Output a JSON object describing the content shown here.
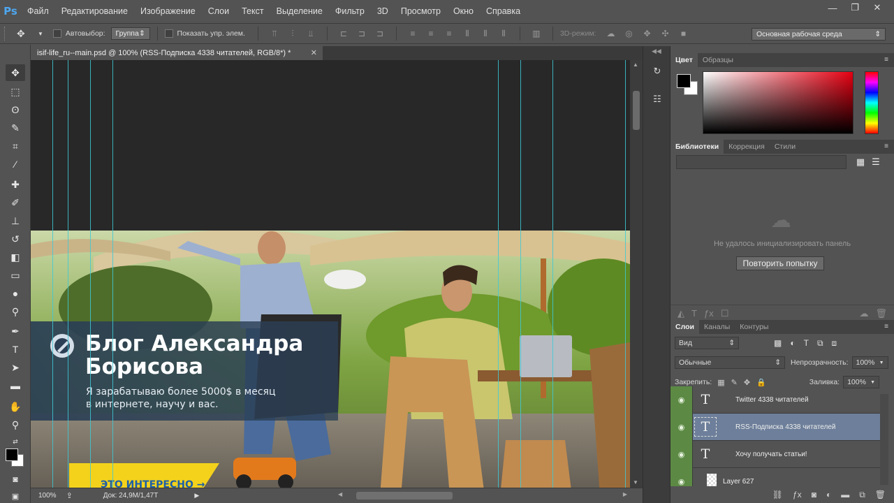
{
  "app": {
    "logo": "Ps"
  },
  "menu": [
    "Файл",
    "Редактирование",
    "Изображение",
    "Слои",
    "Текст",
    "Выделение",
    "Фильтр",
    "3D",
    "Просмотр",
    "Окно",
    "Справка"
  ],
  "window_controls": [
    "—",
    "❐",
    "✕"
  ],
  "options": {
    "autoselect_label": "Автовыбор:",
    "autoselect_value": "Группа",
    "show_transform_label": "Показать упр. элем.",
    "mode3d_label": "3D-режим:",
    "workspace": "Основная рабочая среда"
  },
  "document": {
    "tab_title": "isif-life_ru--main.psd @ 100% (RSS-Подписка 4338 читателей, RGB/8*) *",
    "zoom": "100%",
    "doc_size": "Док: 24,9М/1,47Т"
  },
  "banner": {
    "title_line1": "Блог Александра",
    "title_line2": "Борисова",
    "subtitle_line1": "Я зарабатываю более 5000$ в месяц",
    "subtitle_line2": "в интернете, научу и вас.",
    "cta": "ЭТО ИНТЕРЕСНО →"
  },
  "color_panel": {
    "tabs": [
      "Цвет",
      "Образцы"
    ]
  },
  "libraries_panel": {
    "tabs": [
      "Библиотеки",
      "Коррекция",
      "Стили"
    ],
    "error_message": "Не удалось инициализировать панель",
    "retry_button": "Повторить попытку"
  },
  "layers_panel": {
    "tabs": [
      "Слои",
      "Каналы",
      "Контуры"
    ],
    "filter_kind": "Вид",
    "blend_mode": "Обычные",
    "opacity_label": "Непрозрачность:",
    "opacity_value": "100%",
    "lock_label": "Закрепить:",
    "fill_label": "Заливка:",
    "fill_value": "100%",
    "layers": [
      {
        "name": "Twitter 4338 читателей",
        "type": "T"
      },
      {
        "name": "RSS-Подписка 4338 читателей",
        "type": "T"
      },
      {
        "name": "Хочу получать статьи!",
        "type": "T"
      },
      {
        "name": "Layer 627",
        "type": ""
      }
    ]
  }
}
